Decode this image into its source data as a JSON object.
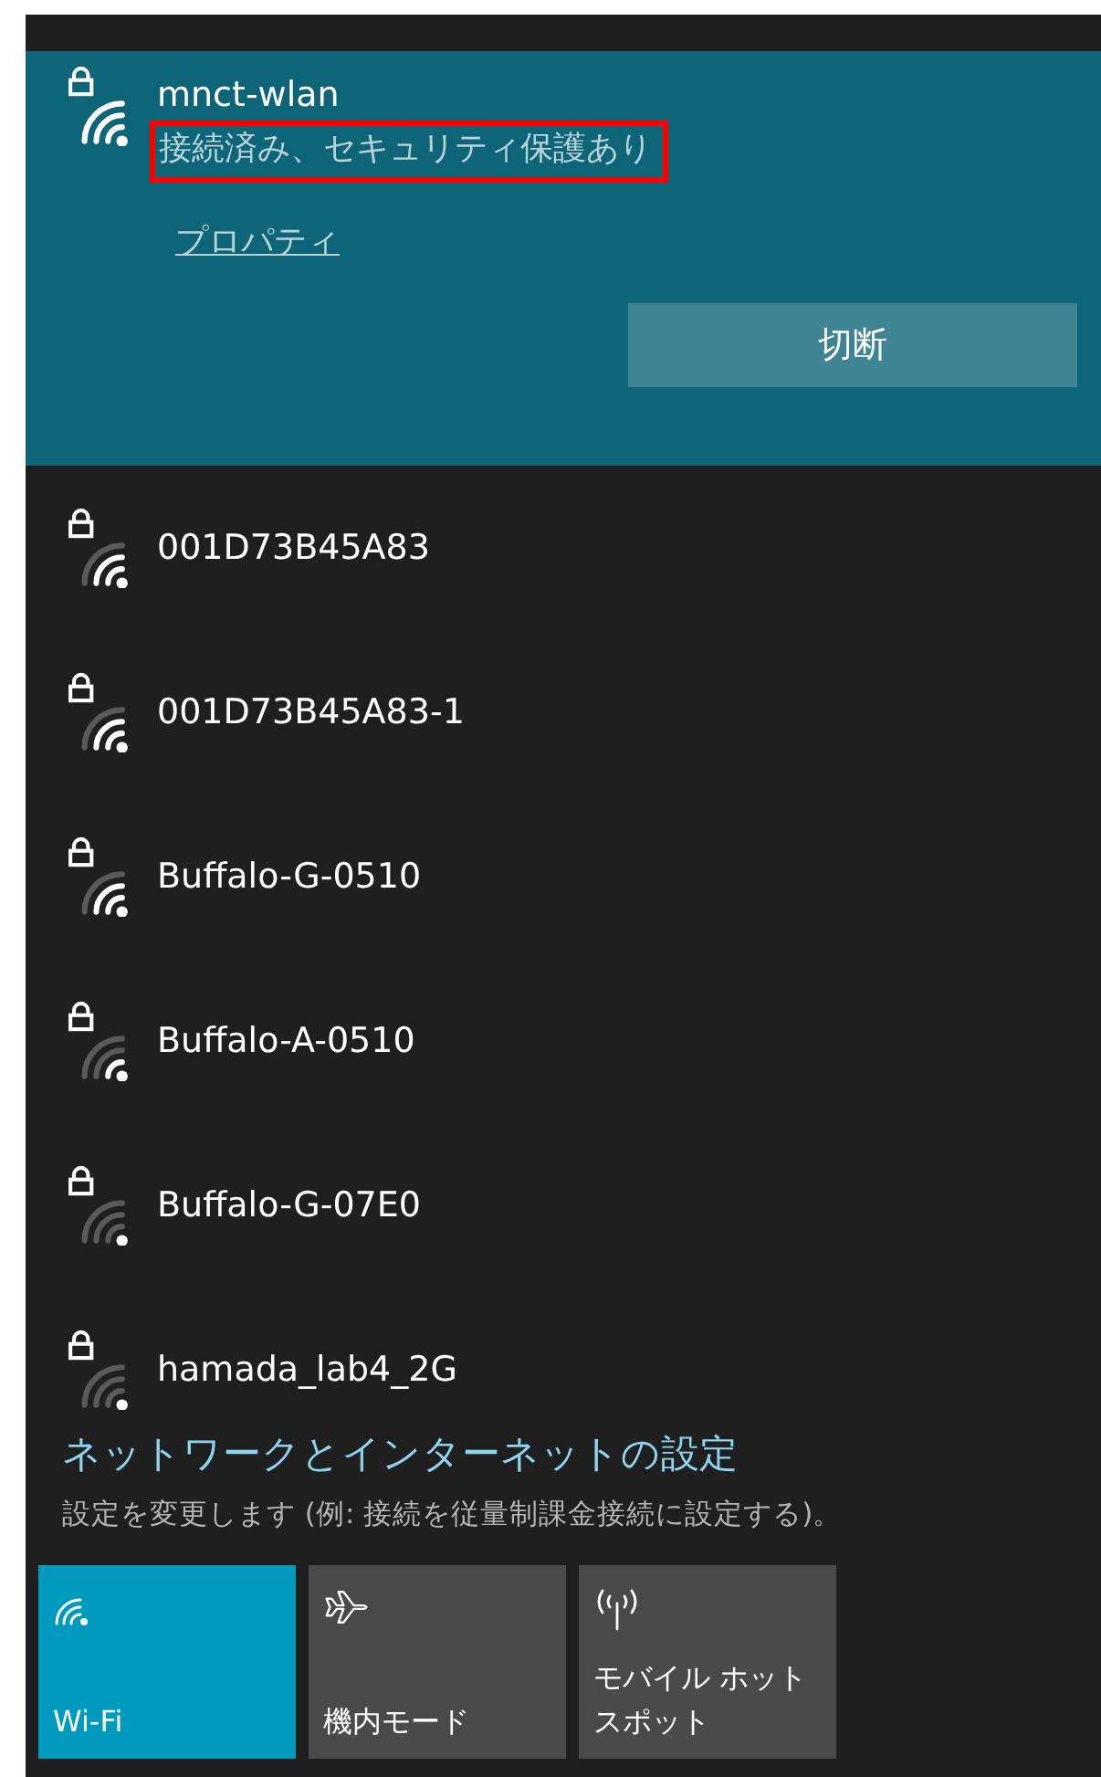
{
  "connected": {
    "name": "mnct-wlan",
    "secured": true,
    "kind": "full",
    "status": {
      "text": "接続済み、セキュリティ保護あり",
      "highlighted": true
    },
    "properties_link": "プロパティ",
    "disconnect_button": "切断"
  },
  "networks": [
    {
      "kind": "strong",
      "name": "001D73B45A83",
      "secured": true
    },
    {
      "kind": "strong",
      "name": "001D73B45A83-1",
      "secured": true
    },
    {
      "kind": "strong",
      "name": "Buffalo-G-0510",
      "secured": true
    },
    {
      "kind": "medium",
      "name": "Buffalo-A-0510",
      "secured": true
    },
    {
      "kind": "weak",
      "name": "Buffalo-G-07E0",
      "secured": true
    },
    {
      "kind": "weak",
      "name": "hamada_lab4_2G",
      "secured": true
    }
  ],
  "settings": {
    "link": "ネットワークとインターネットの設定",
    "description": "設定を変更します (例: 接続を従量制課金接続に設定する)。"
  },
  "quick_actions": [
    {
      "kind": "wifi",
      "label": "Wi-Fi",
      "on": true
    },
    {
      "kind": "airplane",
      "label": "機内モード",
      "on": false
    },
    {
      "kind": "hotspot",
      "label": "モバイル ホットスポット",
      "on": false
    }
  ]
}
